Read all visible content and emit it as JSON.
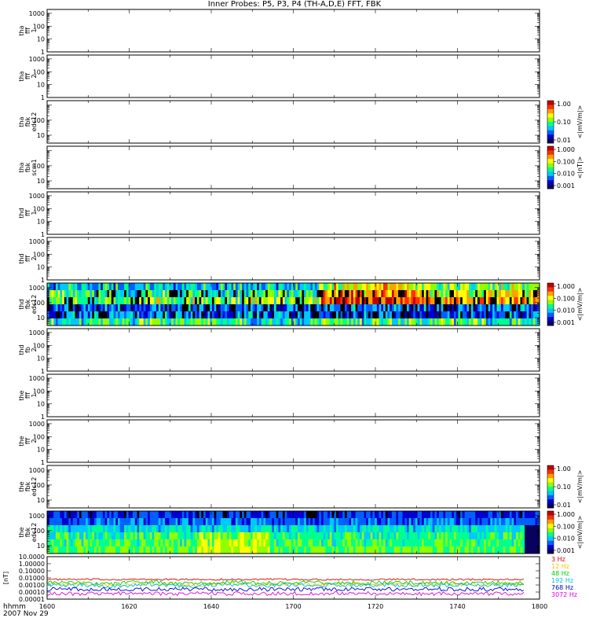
{
  "title": "Inner Probes: P5, P3, P4 (TH-A,D,E) FFT, FBK",
  "footer": {
    "line1": "hhmm",
    "line2": "2007 Nov 29"
  },
  "chart_data": {
    "type": "heatmap",
    "x_axis": {
      "range": [
        1600,
        1800
      ],
      "major_ticks": [
        "1600",
        "1620",
        "1640",
        "1700",
        "1720",
        "1740",
        "1800"
      ],
      "units": "hhmm"
    },
    "panels": [
      {
        "label": [
          "tha",
          "fff",
          "1"
        ],
        "yticks": [
          "1000",
          "100",
          "10",
          "1"
        ],
        "log_range": [
          1,
          2000
        ]
      },
      {
        "label": [
          "tha",
          "fff",
          "2"
        ],
        "yticks": [
          "1000",
          "100",
          "10",
          "1"
        ],
        "log_range": [
          1,
          2000
        ]
      },
      {
        "label": [
          "tha",
          "fbk",
          "edc12"
        ],
        "yticks": [
          "100",
          "10"
        ],
        "log_range": [
          3,
          2000
        ],
        "colorbar": {
          "ticks": [
            "1.00",
            "0.10",
            "0.01"
          ],
          "units": "<|mV/m|>"
        }
      },
      {
        "label": [
          "tha",
          "fbk",
          "scm1"
        ],
        "yticks": [
          "100",
          "10"
        ],
        "log_range": [
          3,
          2000
        ],
        "colorbar": {
          "ticks": [
            "1.000",
            "0.100",
            "0.010",
            "0.001"
          ],
          "units": "<|nT|>"
        }
      },
      {
        "label": [
          "thd",
          "fff",
          "1"
        ],
        "yticks": [
          "1000",
          "100",
          "10",
          "1"
        ],
        "log_range": [
          1,
          2000
        ]
      },
      {
        "label": [
          "thd",
          "fff",
          "2"
        ],
        "yticks": [
          "1000",
          "100",
          "10",
          "1"
        ],
        "log_range": [
          1,
          2000
        ]
      },
      {
        "label": [
          "thd",
          "fbk",
          "edc12"
        ],
        "yticks": [
          "1000",
          "100",
          "10"
        ],
        "log_range": [
          3,
          2000
        ],
        "colorbar": {
          "ticks": [
            "1.000",
            "0.100",
            "0.010",
            "0.001"
          ],
          "units": "<|mV/m|>"
        },
        "spectrogram": "thd_edc12"
      },
      {
        "label": [
          "thd",
          "fb",
          "2"
        ],
        "yticks": [
          "1000",
          "100",
          "10",
          "1"
        ],
        "log_range": [
          1,
          2000
        ]
      },
      {
        "label": [
          "the",
          "fff",
          "1"
        ],
        "yticks": [
          "1000",
          "100",
          "10",
          "1"
        ],
        "log_range": [
          1,
          2000
        ]
      },
      {
        "label": [
          "the",
          "fff",
          "2"
        ],
        "yticks": [
          "1000",
          "100",
          "10",
          "1"
        ],
        "log_range": [
          1,
          2000
        ]
      },
      {
        "label": [
          "the",
          "fbk",
          "edc12"
        ],
        "yticks": [
          "1000",
          "100",
          "10"
        ],
        "log_range": [
          3,
          2000
        ],
        "colorbar": {
          "ticks": [
            "1.00",
            "0.10",
            "0.01"
          ],
          "units": "<|mV/m|>"
        }
      },
      {
        "label": [
          "the",
          "fbk",
          "edc12"
        ],
        "yticks": [
          "1000",
          "100",
          "10"
        ],
        "log_range": [
          3,
          2000
        ],
        "colorbar": {
          "ticks": [
            "1.000",
            "0.100",
            "0.010",
            "0.001"
          ],
          "units": "<|mV/m|>"
        },
        "spectrogram": "the_edc12"
      }
    ],
    "line_panel": {
      "ylabel": "[nT]",
      "yticks": [
        "10.0000",
        "1.00000",
        "0.10000",
        "0.01000",
        "0.00100",
        "0.00010",
        "0.00001"
      ],
      "legend": [
        {
          "name": "3 Hz",
          "color": "#e00000"
        },
        {
          "name": "12 Hz",
          "color": "#ffc000"
        },
        {
          "name": "48 Hz",
          "color": "#00d000"
        },
        {
          "name": "192 Hz",
          "color": "#00c0e0"
        },
        {
          "name": "768 Hz",
          "color": "#0000d0"
        },
        {
          "name": "3072 Hz",
          "color": "#e000e0"
        }
      ],
      "series_levels": [
        {
          "name": "3 Hz",
          "value": 0.006
        },
        {
          "name": "12 Hz",
          "value": 0.0012
        },
        {
          "name": "48 Hz",
          "value": 0.002
        },
        {
          "name": "192 Hz",
          "value": 0.0009
        },
        {
          "name": "768 Hz",
          "value": 0.00025
        },
        {
          "name": "3072 Hz",
          "value": 6e-05
        }
      ]
    },
    "colormap": [
      "#0a0060",
      "#0000d0",
      "#0060ff",
      "#00c8ff",
      "#00ff90",
      "#90ff00",
      "#ffff00",
      "#ffa000",
      "#ff3000",
      "#c00000"
    ]
  }
}
